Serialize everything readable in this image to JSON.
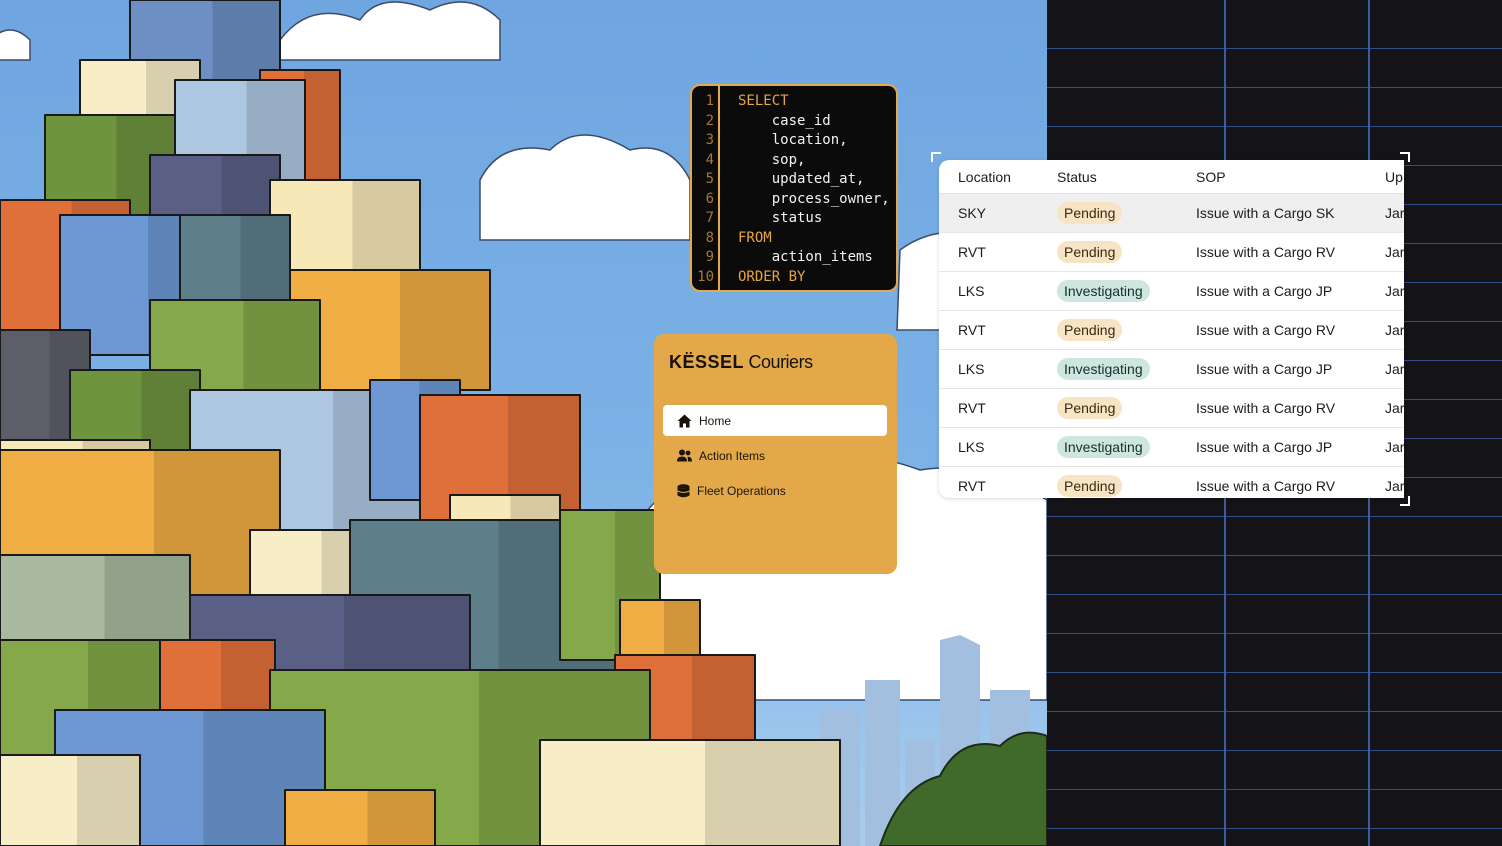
{
  "sql_editor": {
    "lines": [
      {
        "n": "1",
        "text": "SELECT",
        "kind": "kw"
      },
      {
        "n": "2",
        "text": "    case_id",
        "kind": "id"
      },
      {
        "n": "3",
        "text": "    location,",
        "kind": "id"
      },
      {
        "n": "4",
        "text": "    sop,",
        "kind": "id"
      },
      {
        "n": "5",
        "text": "    updated_at,",
        "kind": "id"
      },
      {
        "n": "6",
        "text": "    process_owner,",
        "kind": "id"
      },
      {
        "n": "7",
        "text": "    status",
        "kind": "id"
      },
      {
        "n": "8",
        "text": "FROM",
        "kind": "kw"
      },
      {
        "n": "9",
        "text": "    action_items",
        "kind": "id"
      },
      {
        "n": "10",
        "text": "ORDER BY",
        "kind": "kw"
      }
    ]
  },
  "nav": {
    "brand_bold": "KËSSEL",
    "brand_rest": "Couriers",
    "items": [
      {
        "label": "Home",
        "icon": "home-icon"
      },
      {
        "label": "Action Items",
        "icon": "users-icon"
      },
      {
        "label": "Fleet Operations",
        "icon": "database-icon"
      }
    ]
  },
  "table": {
    "columns": [
      "Location",
      "Status",
      "SOP",
      "Up"
    ],
    "rows": [
      {
        "location": "SKY",
        "status": "Pending",
        "sop": "Issue with a Cargo SK",
        "updated": "Jar"
      },
      {
        "location": "RVT",
        "status": "Pending",
        "sop": "Issue with a Cargo RV",
        "updated": "Jar"
      },
      {
        "location": "LKS",
        "status": "Investigating",
        "sop": "Issue with a Cargo JP",
        "updated": "Jar"
      },
      {
        "location": "RVT",
        "status": "Pending",
        "sop": "Issue with a Cargo RV",
        "updated": "Jar"
      },
      {
        "location": "LKS",
        "status": "Investigating",
        "sop": "Issue with a Cargo JP",
        "updated": "Jar"
      },
      {
        "location": "RVT",
        "status": "Pending",
        "sop": "Issue with a Cargo RV",
        "updated": "Jar"
      },
      {
        "location": "LKS",
        "status": "Investigating",
        "sop": "Issue with a Cargo JP",
        "updated": "Jar"
      },
      {
        "location": "RVT",
        "status": "Pending",
        "sop": "Issue with a Cargo RV",
        "updated": "Jar"
      }
    ]
  },
  "colors": {
    "accent": "#e2a84a",
    "pending_badge": "#f6e4c4",
    "investigating_badge": "#cde6e0",
    "grid_lines": "#3b5f9c"
  }
}
